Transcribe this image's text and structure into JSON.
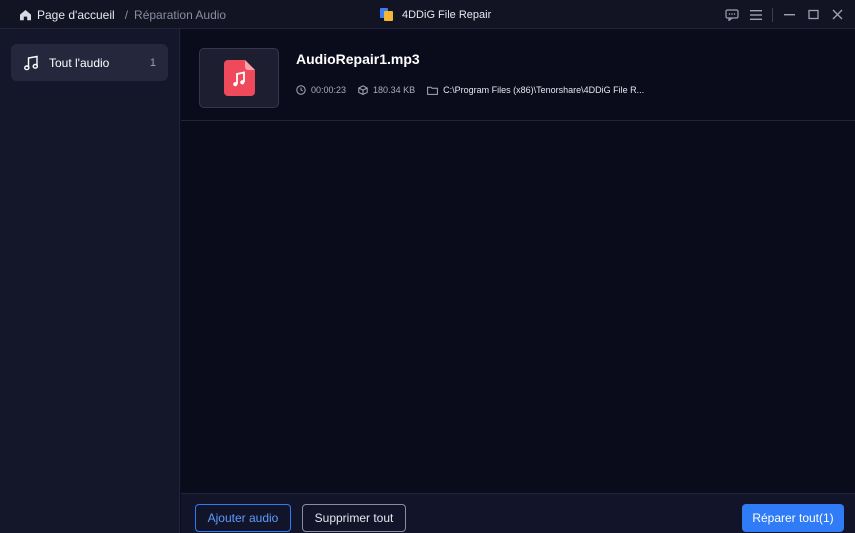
{
  "breadcrumb": {
    "home_label": "Page d'accueil",
    "separator": "/",
    "current_label": "Réparation Audio"
  },
  "app": {
    "title": "4DDiG File Repair"
  },
  "window_controls": [
    "feedback-icon",
    "menu-icon",
    "minimize-icon",
    "maximize-icon",
    "close-icon"
  ],
  "sidebar": {
    "items": [
      {
        "label": "Tout l'audio",
        "count": "1",
        "icon": "music-note-icon"
      }
    ]
  },
  "files": [
    {
      "name": "AudioRepair1.mp3",
      "duration": "00:00:23",
      "size": "180.34 KB",
      "path": "C:\\Program Files (x86)\\Tenorshare\\4DDiG File R..."
    }
  ],
  "footer": {
    "add_label": "Ajouter audio",
    "delete_label": "Supprimer tout",
    "repair_label": "Réparer tout(1)"
  },
  "colors": {
    "accent": "#2f7cf6",
    "file_icon": "#ef4a5b",
    "background": "#0b0c1b"
  }
}
